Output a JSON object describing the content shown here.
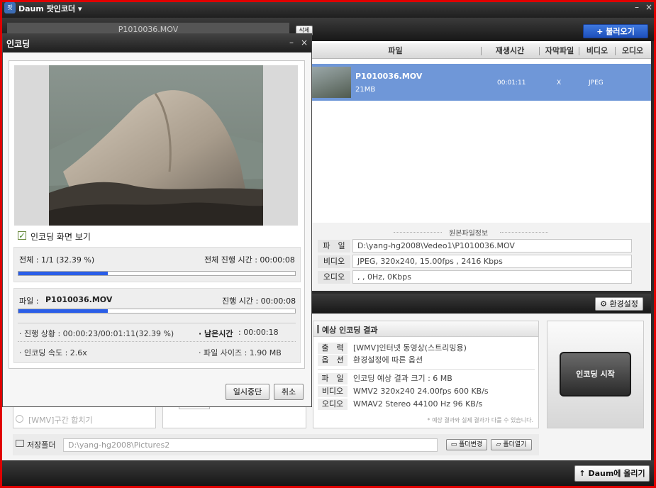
{
  "app": {
    "title": "Daum 팟인코더 ▾",
    "minimize": "–",
    "close": "×"
  },
  "top_tab": {
    "label": "P1010036.MOV",
    "delete": "삭제",
    "load_button": "+ 불러오기"
  },
  "file_table": {
    "headers": [
      "파일",
      "재생시간",
      "자막파일",
      "비디오",
      "오디오"
    ],
    "rows": [
      {
        "name": "P1010036.MOV",
        "size": "21MB",
        "duration": "00:01:11",
        "subtitle": "X",
        "video": "JPEG"
      }
    ]
  },
  "source_info": {
    "title": "원본파일정보",
    "rows": [
      {
        "label": "파　일",
        "value": "D:\\yang-hg2008\\Vedeo1\\P1010036.MOV"
      },
      {
        "label": "비디오",
        "value": "JPEG, 320x240, 15.00fps , 2416 Kbps"
      },
      {
        "label": "오디오",
        "value": ", , 0Hz, 0Kbps"
      }
    ]
  },
  "settings_button": "환경설정",
  "expected": {
    "title": "예상 인코딩 결과",
    "rows1": [
      {
        "label": "출　력",
        "value": "[WMV]인터넷 동영상(스트리밍용)"
      },
      {
        "label": "옵　션",
        "value": "환경설정에 따른 옵션"
      }
    ],
    "rows2": [
      {
        "label": "파　일",
        "value": "인코딩 예상 결과 크기 : 6 MB"
      },
      {
        "label": "비디오",
        "value": "WMV2 320x240 24.00fps  600 KB/s"
      },
      {
        "label": "오디오",
        "value": "WMAV2 Stereo 44100 Hz 96 KB/s"
      }
    ],
    "note": "* 예상 결과와 실제 결과가 다를 수 있습니다."
  },
  "start_button": "인코딩 시작",
  "merge_option": "[WMV]구간 합치기",
  "save_folder": {
    "label": "저장폴더",
    "path": "D:\\yang-hg2008\\Pictures2",
    "change": "폴더변경",
    "open": "폴더열기"
  },
  "upload_button": "Daum에 올리기",
  "dialog": {
    "title": "인코딩",
    "minimize": "–",
    "close": "×",
    "show_preview": "인코딩 화면 보기",
    "overall": {
      "label": "전체 : 1/1 (32.39 %)",
      "time": "전체 진행 시간 : 00:00:08",
      "progress": 0.3239
    },
    "file": {
      "label": "파일 :",
      "name": "P1010036.MOV",
      "time": "진행 시간 : 00:00:08",
      "progress": 0.3239
    },
    "status": "· 진행 상황 : 00:00:23/00:01:11(32.39 %)",
    "remaining_label": "· 남은시간",
    "remaining_value": " : 00:00:18",
    "speed": "· 인코딩 속도 : 2.6x",
    "filesize": "· 파일 사이즈 : 1.90 MB",
    "pause": "일시중단",
    "cancel": "취소"
  }
}
